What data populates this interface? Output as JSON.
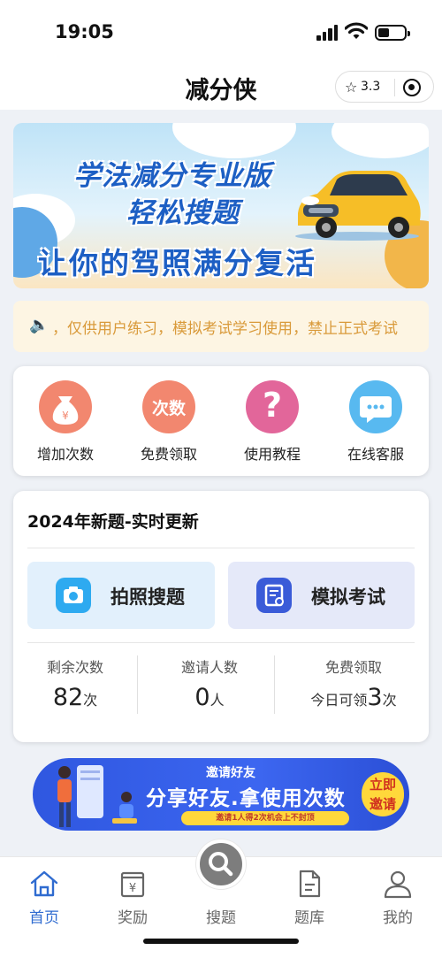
{
  "status_bar": {
    "time": "19:05"
  },
  "nav": {
    "title": "减分侠",
    "rating": "3.3"
  },
  "banner": {
    "line1": "学法减分专业版",
    "line2": "轻松搜题",
    "line3": "让你的驾照满分复活"
  },
  "notice": {
    "text": "，仅供用户练习，模拟考试学习使用，禁止正式考试"
  },
  "quick_actions": [
    {
      "label": "增加次数",
      "icon": "money-bag-icon",
      "color": "#f2876f"
    },
    {
      "label": "免费领取",
      "icon": "times-badge-icon",
      "color": "#f2876f",
      "badge": "次数"
    },
    {
      "label": "使用教程",
      "icon": "question-icon",
      "color": "#e2669a"
    },
    {
      "label": "在线客服",
      "icon": "chat-bubble-icon",
      "color": "#58b9f0"
    }
  ],
  "main_card": {
    "title": "2024年新题-实时更新",
    "photo_search": "拍照搜题",
    "mock_exam": "模拟考试",
    "stats": [
      {
        "label": "剩余次数",
        "value": "82",
        "unit": "次",
        "prefix": ""
      },
      {
        "label": "邀请人数",
        "value": "0",
        "unit": "人",
        "prefix": ""
      },
      {
        "label": "免费领取",
        "value": "3",
        "unit": "次",
        "prefix": "今日可领"
      }
    ]
  },
  "invite": {
    "top": "邀请好友",
    "main": "分享好友.拿使用次数",
    "sub": "邀请1人得2次机会上不封顶",
    "button": "立即邀请"
  },
  "tabs": [
    {
      "label": "首页",
      "icon": "home-icon",
      "active": true
    },
    {
      "label": "奖励",
      "icon": "reward-icon",
      "active": false
    },
    {
      "label": "搜题",
      "icon": "search-icon",
      "active": false
    },
    {
      "label": "题库",
      "icon": "document-icon",
      "active": false
    },
    {
      "label": "我的",
      "icon": "user-icon",
      "active": false
    }
  ],
  "colors": {
    "accent": "#1d5fc4",
    "tab_active": "#2f6bd0",
    "notice": "#d99a3a"
  }
}
